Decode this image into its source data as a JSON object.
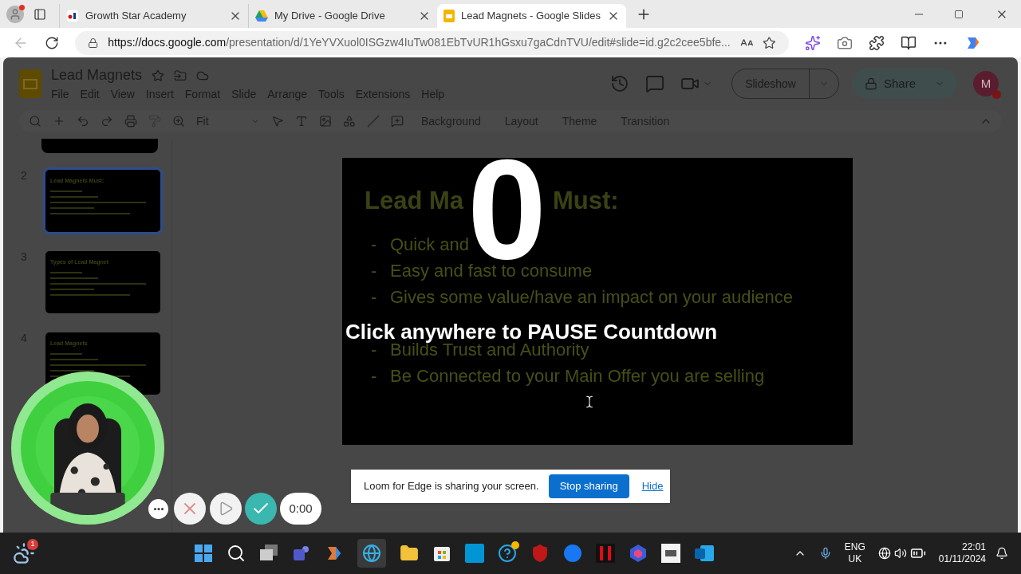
{
  "browser": {
    "tabs": [
      {
        "title": "Growth Star Academy",
        "selected": false,
        "kind": "sk"
      },
      {
        "title": "My Drive - Google Drive",
        "selected": false,
        "kind": "drive"
      },
      {
        "title": "Lead Magnets - Google Slides",
        "selected": true,
        "kind": "slides"
      }
    ],
    "url_host": "https://docs.google.com",
    "url_path": "/presentation/d/1YeYVXuol0ISGzw4IuTw081EbTvUR1hGsxu7gaCdnTVU/edit#slide=id.g2c2cee5bfe..."
  },
  "app": {
    "title": "Lead Magnets",
    "menu": [
      "File",
      "Edit",
      "View",
      "Insert",
      "Format",
      "Slide",
      "Arrange",
      "Tools",
      "Extensions",
      "Help"
    ],
    "zoom": "Fit",
    "toolbar_buttons": [
      "Background",
      "Layout",
      "Theme",
      "Transition"
    ],
    "slideshow": "Slideshow",
    "share": "Share",
    "avatar": "M"
  },
  "thumbnails": [
    {
      "number": "2",
      "title": "Lead Magnets Must:",
      "selected": true
    },
    {
      "number": "3",
      "title": "Types of Lead Magnet",
      "selected": false
    },
    {
      "number": "4",
      "title": "Lead Magnets",
      "selected": false
    }
  ],
  "slide": {
    "title_parts": [
      "Lead Ma",
      "Must:"
    ],
    "bullets": [
      {
        "marker": "-",
        "text": "Quick and"
      },
      {
        "marker": "-",
        "text": "Easy and fast to consume"
      },
      {
        "marker": "-",
        "text": "Gives some value/have an impact on your audience"
      }
    ],
    "bullets_lower": [
      {
        "marker": "-",
        "text": "Builds Trust and Authority"
      },
      {
        "marker": "-",
        "text": "Be Connected to your Main Offer you are selling"
      }
    ]
  },
  "countdown": {
    "number": "0",
    "message": "Click anywhere to PAUSE Countdown"
  },
  "loom_bar": {
    "message": "Loom for Edge is sharing your screen.",
    "stop": "Stop sharing",
    "hide": "Hide"
  },
  "recorder": {
    "timer": "0:00"
  },
  "taskbar": {
    "weather_badge": "1",
    "language": "ENG",
    "region": "UK",
    "time": "22:01",
    "date": "01/11/2024"
  }
}
